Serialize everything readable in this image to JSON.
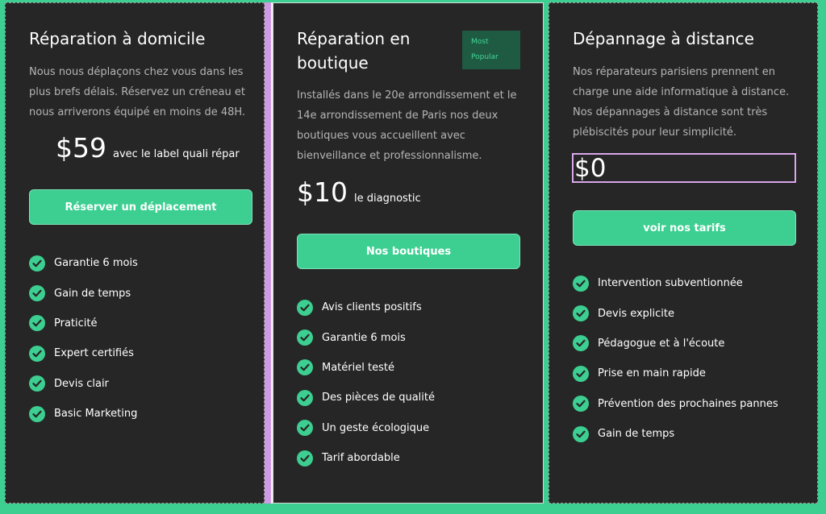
{
  "cards": [
    {
      "title": "Réparation à domicile",
      "description": "Nous nous déplaçons chez vous dans les plus brefs délais. Réservez un créneau et nous arriverons équipé en moins de 48H.",
      "price": "$59",
      "price_note": "avec le label quali répar",
      "button_label": "Réserver un déplacement",
      "features": [
        "Garantie 6 mois",
        "Gain de temps",
        "Praticité",
        "Expert certifiés",
        "Devis clair",
        "Basic Marketing"
      ]
    },
    {
      "title": "Réparation en boutique",
      "badge": "Most Popular",
      "description": "Installés dans le 20e arrondissement et le 14e arrondissement de Paris nos deux boutiques vous accueillent avec bienveillance et professionnalisme.",
      "price": "$10",
      "price_note": "le diagnostic",
      "button_label": "Nos boutiques",
      "features": [
        "Avis clients positifs",
        "Garantie 6 mois",
        "Matériel testé",
        "Des pièces de qualité",
        "Un geste écologique",
        "Tarif abordable"
      ]
    },
    {
      "title": "Dépannage à distance",
      "description": "Nos réparateurs parisiens prennent en charge une aide informatique à distance. Nos dépannages à distance sont très plébiscités pour leur simplicité.",
      "price": "$0",
      "button_label": "voir nos tarifs",
      "features": [
        "Intervention subventionnée",
        "Devis explicite",
        "Pédagogue et à l'écoute",
        "Prise en main rapide",
        "Prévention des prochaines pannes",
        "Gain de temps"
      ]
    }
  ],
  "colors": {
    "accent": "#3ccf91",
    "card_bg": "#262626",
    "badge_bg": "#1f5a42",
    "selection": "#d9a6ea"
  },
  "icons": {
    "feature": "check-circle-icon",
    "handle": "block-handle-icon"
  }
}
